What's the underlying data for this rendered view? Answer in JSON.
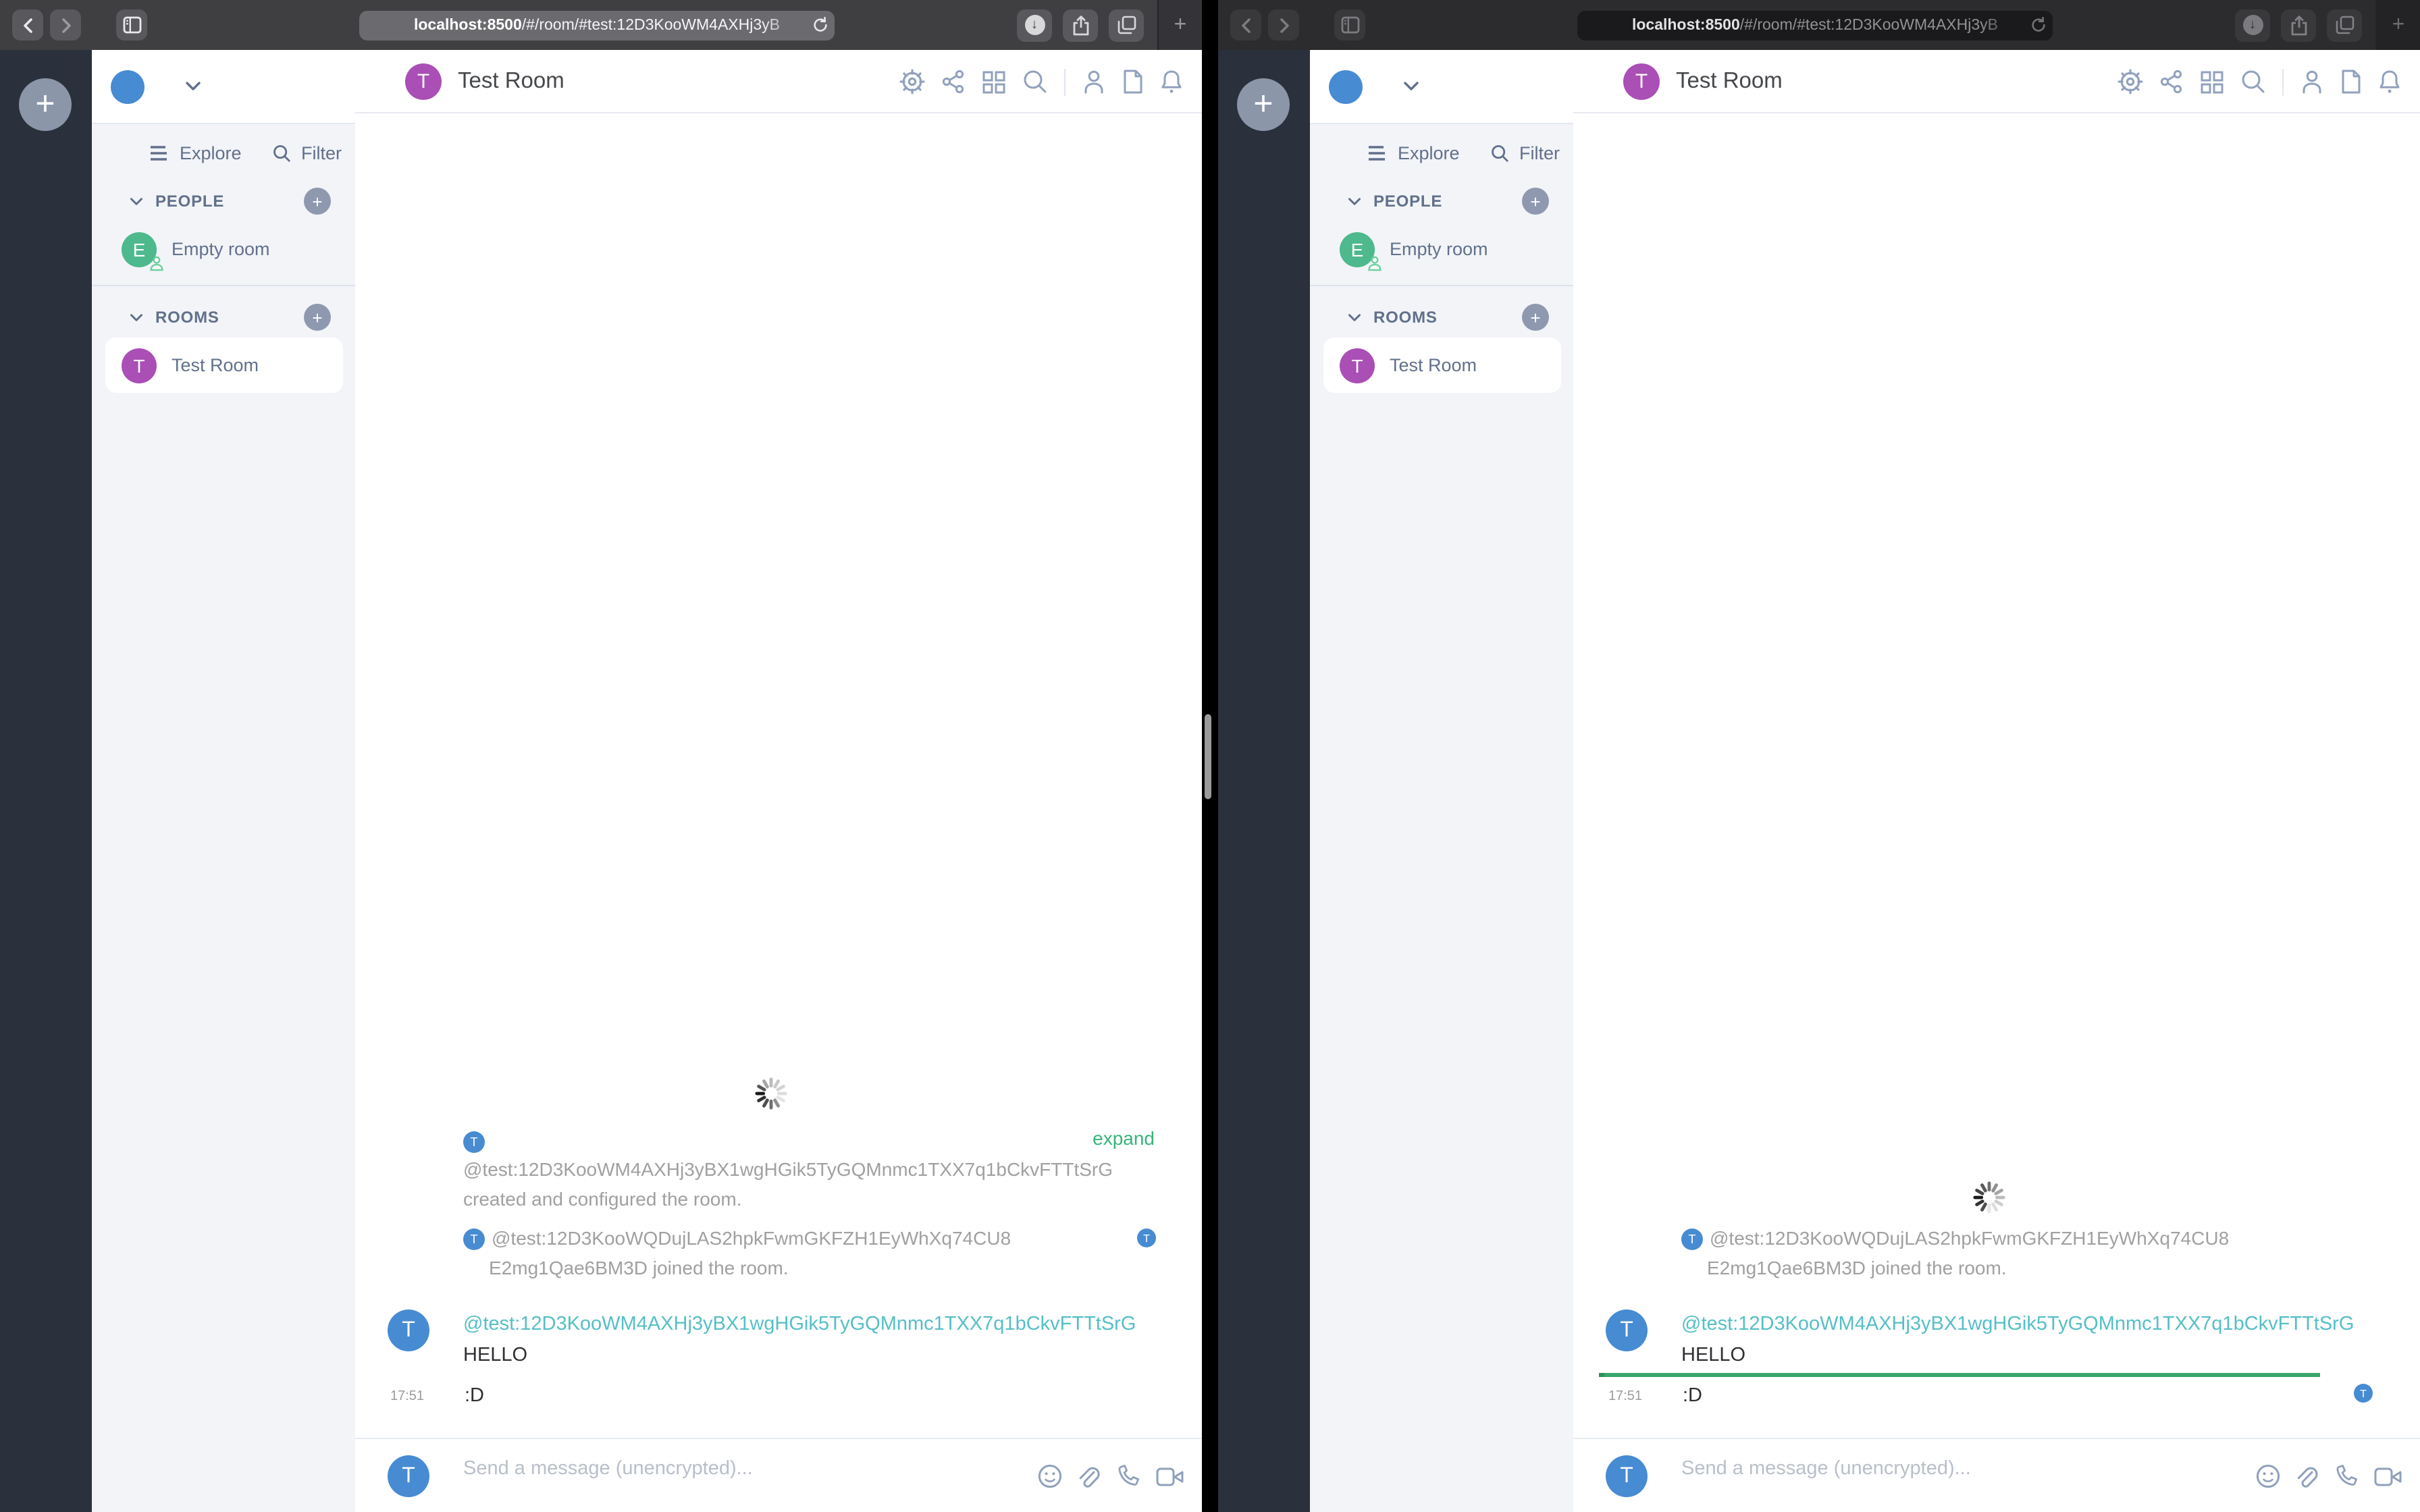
{
  "chrome": {
    "url_host": "localhost:8500",
    "url_path": "/#/room/#test:12D3KooWM4AXHj3yB",
    "new_tab_label": "+"
  },
  "spaces": {
    "add_label": "+"
  },
  "sidebar": {
    "explore_label": "Explore",
    "filter_label": "Filter",
    "people_header": "PEOPLE",
    "rooms_header": "ROOMS",
    "people": [
      {
        "name": "Empty room",
        "avatar_letter": "E"
      }
    ],
    "rooms": [
      {
        "name": "Test Room",
        "avatar_letter": "T"
      }
    ],
    "add_label": "+"
  },
  "header": {
    "room_name": "Test Room",
    "avatar_letter": "T"
  },
  "events": {
    "avatar_letter": "T",
    "creator_id": "@test:12D3KooWM4AXHj3yBX1wgHGik5TyGQMnmc1TXX7q1bCkvFTTtSrG",
    "creation_action": "created and configured the room.",
    "expand_link": "expand",
    "joiner_line1": "@test:12D3KooWQDujLAS2hpkFwmGKFZH1EyWhXq74CU8",
    "joiner_line2": "E2mg1Qae6BM3D joined the room.",
    "sender_id": "@test:12D3KooWM4AXHj3yBX1wgHGik5TyGQMnmc1TXX7q1bCkvFTTtSrG",
    "message_hello": "HELLO",
    "message_smile": ":D",
    "timestamp": "17:51"
  },
  "composer": {
    "placeholder": "Send a message (unencrypted)..."
  },
  "colors": {
    "accent_green": "#36b579",
    "unread_marker_green": "#38a76c",
    "sender_teal": "#55bfc6",
    "avatar_blue": "#478bd2",
    "avatar_purple": "#a94fb5",
    "avatar_green": "#4db98c",
    "space_bar_dark": "#2a313c",
    "sidebar_bg": "#f2f4f8",
    "slate_text": "#61708b"
  }
}
